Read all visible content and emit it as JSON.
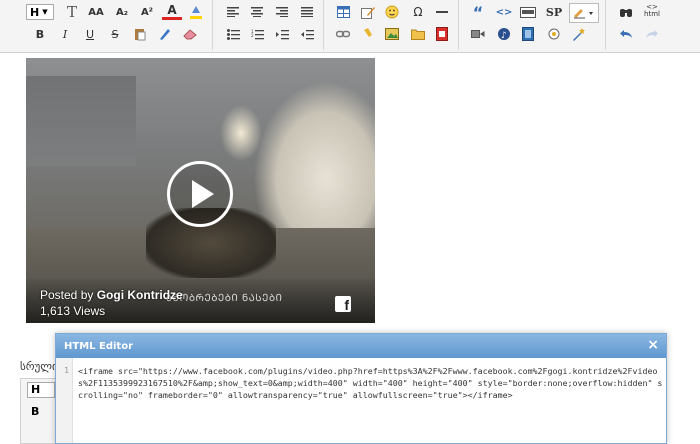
{
  "toolbar": {
    "format_select_value": "H",
    "row1_groupA": [
      "clear-format-icon",
      "font-size-up-icon",
      "subscript-icon",
      "superscript-icon",
      "font-color-icon",
      "highlight-icon"
    ],
    "row2_groupA": [
      "bold-icon",
      "italic-icon",
      "underline-icon",
      "strikethrough-icon",
      "paste-icon",
      "style-brush-icon",
      "eraser-icon"
    ],
    "labels": {
      "bold": "B",
      "italic": "I",
      "underline": "U",
      "strike": "S",
      "omega": "Ω",
      "sp": "SP",
      "quote": "“",
      "html": "html",
      "html_brackets": "<>",
      "aa_upper": "AA",
      "a_sub": "A₂",
      "a_sup": "A²",
      "a_color": "A",
      "t_clear": "T"
    }
  },
  "video": {
    "posted_prefix": "Posted by",
    "author": "Gogi Kontridze",
    "views": "1,613 Views",
    "caption_overlay": "ᲐᲛᲝᲑᲠᲔᲑᲔᲑᲘ ᲜᲐᲡᲔᲑᲘ",
    "platform_icon": "f"
  },
  "lower": {
    "label": "სრული",
    "mini_select": "H",
    "mini_bold": "B"
  },
  "dialog": {
    "title": "HTML Editor",
    "close": "×",
    "line_number": "1",
    "code": "<iframe src=\"https://www.facebook.com/plugins/video.php?href=https%3A%2F%2Fwww.facebook.com%2Fgogi.kontridze%2Fvideos%2F1135399923167510%2F&amp;show_text=0&amp;width=400\" width=\"400\" height=\"400\" style=\"border:none;overflow:hidden\" scrolling=\"no\" frameborder=\"0\" allowtransparency=\"true\" allowfullscreen=\"true\"></iframe>"
  },
  "colors": {
    "dialog_header": "#6fa3d7",
    "toolbar_bg": "#f4f4f4",
    "font_color_red": "#d22",
    "highlight_yellow": "#ffd400"
  }
}
